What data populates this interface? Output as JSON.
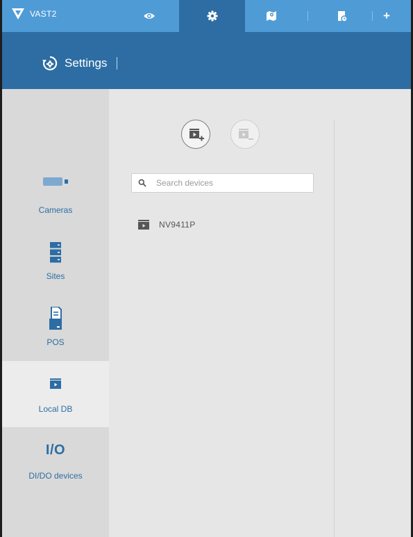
{
  "app": {
    "brand": "VAST2"
  },
  "tabs": [
    {
      "name": "live-view",
      "icon": "eye-icon"
    },
    {
      "name": "settings",
      "icon": "gear-icon",
      "active": true
    },
    {
      "name": "emap",
      "icon": "map-icon"
    },
    {
      "name": "event-log",
      "icon": "document-icon"
    },
    {
      "name": "add-tab",
      "icon": "plus-icon",
      "label": "+"
    }
  ],
  "header": {
    "title": "Settings"
  },
  "sidebar": {
    "items": [
      {
        "label": "Cameras",
        "icon": "camera-icon"
      },
      {
        "label": "Sites",
        "icon": "server-icon"
      },
      {
        "label": "POS",
        "icon": "pos-icon"
      },
      {
        "label": "Local DB",
        "icon": "folder-video-icon",
        "selected": true
      },
      {
        "label": "DI/DO devices",
        "icon": "io-icon",
        "icon_text": "I/O"
      }
    ]
  },
  "main": {
    "search": {
      "placeholder": "Search devices",
      "value": ""
    },
    "devices": [
      {
        "name": "NV9411P"
      }
    ]
  },
  "colors": {
    "topbar": "#4f9bd6",
    "header": "#2d6da3",
    "accent": "#2d6da3",
    "sidebar_bg": "#d9d9d9"
  }
}
